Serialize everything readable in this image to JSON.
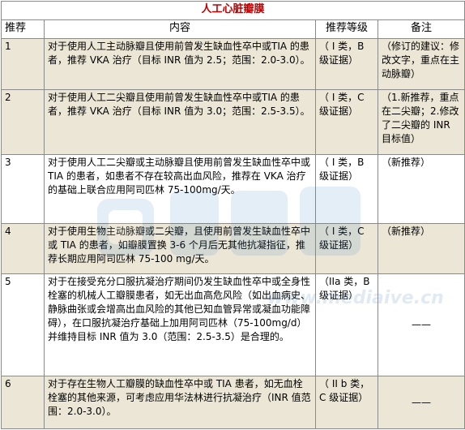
{
  "table": {
    "title": "人工心脏瓣膜",
    "headers": {
      "no": "推荐",
      "content": "内容",
      "grade": "推荐等级",
      "note": "备注"
    },
    "rows": [
      {
        "no": "1",
        "content": "对于使用人工主动脉瓣且使用前曾发生缺血性卒中或TIA 的患者，推荐 VKA 治疗（目标 INR 值为 2.5；范围：2.0-3.0）。",
        "grade": "（ I 类，B 级证据）",
        "note": "（修订的建议：修改文字，重点在主动脉瓣）"
      },
      {
        "no": "2",
        "content": "对于使用人工二尖瓣且使用前曾发生缺血性卒中或TIA 的患者，推荐 VKA 治疗（目标 INR 值为 3.0；范围：2.5-3.5）。",
        "grade": "（ I 类，C 级证据）",
        "note": "（1.新推荐，重点在二尖瓣；2.修改了二尖瓣的 INR 目标值）"
      },
      {
        "no": "3",
        "content": "对于使用人工二尖瓣或主动脉瓣且使用前曾发生缺血性卒中或 TIA 的患者，如患者不存在较高出血风险，推荐在 VKA 治疗的基础上联合应用阿司匹林 75-100mg/天。",
        "grade": "（ I 类，B 级证据）",
        "note": "（新推荐）"
      },
      {
        "no": "4",
        "content": "对于使用生物主动脉瓣或二尖瓣，且使用前曾发生缺血性卒中或 TIA 的患者，如瓣膜置换 3-6 个月后无其他抗凝指征，推荐长期应用阿司匹林 75-100 mg/天。",
        "grade": "（ I 类，C 级证据）",
        "note": "（新推荐）"
      },
      {
        "no": "5",
        "content": "对于在接受充分口服抗凝治疗期间仍发生缺血性卒中或全身性栓塞的机械人工瓣膜患者，如无出血高危风险（如出血病史、静脉曲张或会增高出血风险的其他已知血管异常或凝血功能障碍），在口服抗凝治疗基础上加用阿司匹林（75-100mg/d）并维持目标 INR 值为 3.0（范围：2.5-3.5）是合理的。",
        "grade": "（IIa 类，B 级证据）",
        "note": "——"
      },
      {
        "no": "6",
        "content": "对于存在生物人工瓣膜的缺血性卒中或 TIA 患者，如无血栓栓塞的其他来源，可考虑应用华法林进行抗凝治疗（INR 值范围：2.0-3.0）。",
        "grade": "（ II b 类，C 级证据）",
        "note": "——"
      }
    ]
  },
  "watermark": {
    "url": "www.mediaive.cn"
  },
  "colors": {
    "title": "#c00000",
    "shaded_row": "#ece6d6",
    "border": "#8a8a8a"
  }
}
